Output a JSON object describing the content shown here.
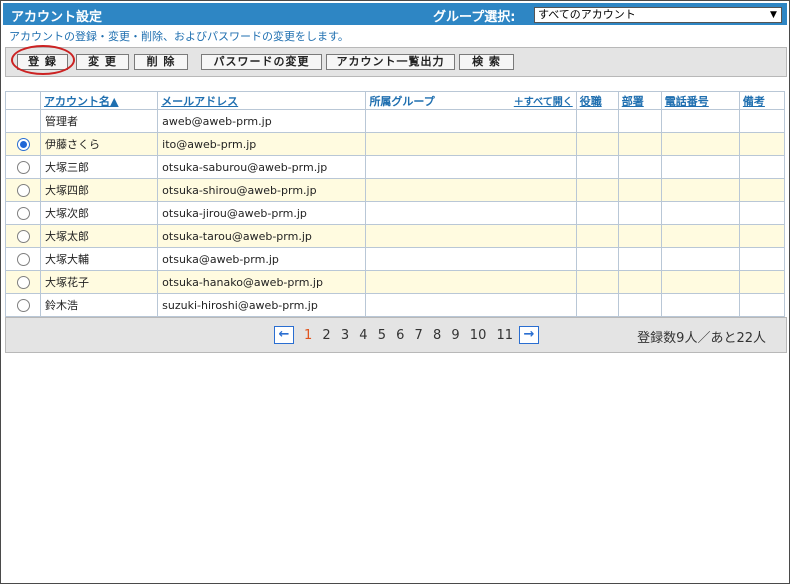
{
  "header": {
    "title": "アカウント設定",
    "group_label": "グループ選択:",
    "group_selected": "すべてのアカウント"
  },
  "description": "アカウントの登録・変更・削除、およびパスワードの変更をします。",
  "toolbar": {
    "register": "登 録",
    "change": "変 更",
    "delete": "削 除",
    "password": "パスワードの変更",
    "export": "アカウント一覧出力",
    "search": "検 索"
  },
  "table": {
    "headers": {
      "account": "アカウント名▲",
      "email": "メールアドレス",
      "group": "所属グループ",
      "open_all": "＋すべて開く",
      "role": "役職",
      "dept": "部署",
      "phone": "電話番号",
      "note": "備考"
    },
    "rows": [
      {
        "name": "管理者",
        "email": "aweb@aweb-prm.jp"
      },
      {
        "name": "伊藤さくら",
        "email": "ito@aweb-prm.jp"
      },
      {
        "name": "大塚三郎",
        "email": "otsuka-saburou@aweb-prm.jp"
      },
      {
        "name": "大塚四郎",
        "email": "otsuka-shirou@aweb-prm.jp"
      },
      {
        "name": "大塚次郎",
        "email": "otsuka-jirou@aweb-prm.jp"
      },
      {
        "name": "大塚太郎",
        "email": "otsuka-tarou@aweb-prm.jp"
      },
      {
        "name": "大塚大輔",
        "email": "otsuka@aweb-prm.jp"
      },
      {
        "name": "大塚花子",
        "email": "otsuka-hanako@aweb-prm.jp"
      },
      {
        "name": "鈴木浩",
        "email": "suzuki-hiroshi@aweb-prm.jp"
      }
    ]
  },
  "pager": {
    "pages": [
      "1",
      "2",
      "3",
      "4",
      "5",
      "6",
      "7",
      "8",
      "9",
      "10",
      "11"
    ],
    "current": "1",
    "count_text": "登録数9人／あと22人"
  }
}
